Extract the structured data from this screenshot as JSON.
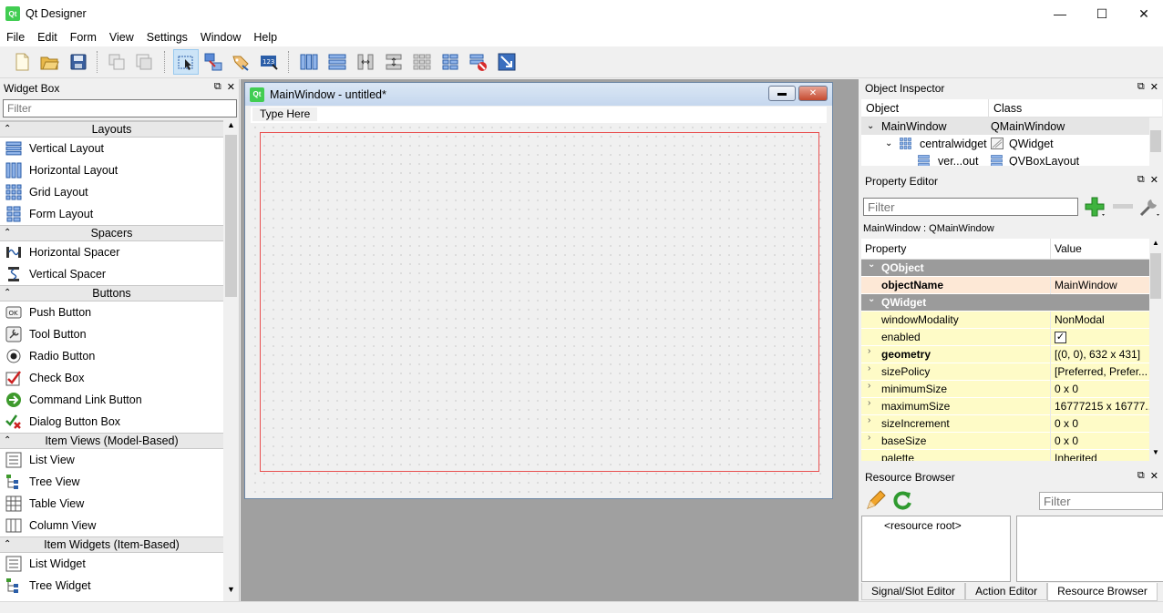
{
  "app": {
    "title": "Qt Designer",
    "icon_text": "Qt"
  },
  "window_controls": {
    "minimize": "—",
    "maximize": "☐",
    "close": "✕"
  },
  "menu": [
    "File",
    "Edit",
    "Form",
    "View",
    "Settings",
    "Window",
    "Help"
  ],
  "widget_box": {
    "title": "Widget Box",
    "filter_placeholder": "Filter",
    "categories": [
      {
        "label": "Layouts",
        "items": [
          "Vertical Layout",
          "Horizontal Layout",
          "Grid Layout",
          "Form Layout"
        ]
      },
      {
        "label": "Spacers",
        "items": [
          "Horizontal Spacer",
          "Vertical Spacer"
        ]
      },
      {
        "label": "Buttons",
        "items": [
          "Push Button",
          "Tool Button",
          "Radio Button",
          "Check Box",
          "Command Link Button",
          "Dialog Button Box"
        ]
      },
      {
        "label": "Item Views (Model-Based)",
        "items": [
          "List View",
          "Tree View",
          "Table View",
          "Column View"
        ]
      },
      {
        "label": "Item Widgets (Item-Based)",
        "items": [
          "List Widget",
          "Tree Widget"
        ]
      }
    ]
  },
  "form": {
    "icon_text": "Qt",
    "title": "MainWindow - untitled*",
    "menubar_placeholder": "Type Here"
  },
  "object_inspector": {
    "title": "Object Inspector",
    "col_object": "Object",
    "col_class": "Class",
    "rows": [
      {
        "object": "MainWindow",
        "class": "QMainWindow"
      },
      {
        "object": "centralwidget",
        "class": "QWidget"
      },
      {
        "object": "ver...out",
        "class": "QVBoxLayout"
      }
    ]
  },
  "property_editor": {
    "title": "Property Editor",
    "filter_placeholder": "Filter",
    "class_label": "MainWindow : QMainWindow",
    "col_property": "Property",
    "col_value": "Value",
    "groups": {
      "qobject": "QObject",
      "qwidget": "QWidget"
    },
    "rows": {
      "objectName": {
        "name": "objectName",
        "value": "MainWindow"
      },
      "windowModality": {
        "name": "windowModality",
        "value": "NonModal"
      },
      "enabled": {
        "name": "enabled",
        "value": ""
      },
      "geometry": {
        "name": "geometry",
        "value": "[(0, 0), 632 x 431]"
      },
      "sizePolicy": {
        "name": "sizePolicy",
        "value": "[Preferred, Prefer..."
      },
      "minimumSize": {
        "name": "minimumSize",
        "value": "0 x 0"
      },
      "maximumSize": {
        "name": "maximumSize",
        "value": "16777215 x 16777..."
      },
      "sizeIncrement": {
        "name": "sizeIncrement",
        "value": "0 x 0"
      },
      "baseSize": {
        "name": "baseSize",
        "value": "0 x 0"
      },
      "palette": {
        "name": "palette",
        "value": "Inherited"
      }
    }
  },
  "resource_browser": {
    "title": "Resource Browser",
    "filter_placeholder": "Filter",
    "root": "<resource root>"
  },
  "tabs": [
    "Signal/Slot Editor",
    "Action Editor",
    "Resource Browser"
  ],
  "dock_buttons": {
    "float": "⧉",
    "close": "✕"
  },
  "colors": {
    "accent": "#41cd52",
    "layout_border": "#e85050",
    "group_row": "#9b9b9b",
    "object_row": "#fde8d6",
    "widget_row": "#fefbc7"
  }
}
